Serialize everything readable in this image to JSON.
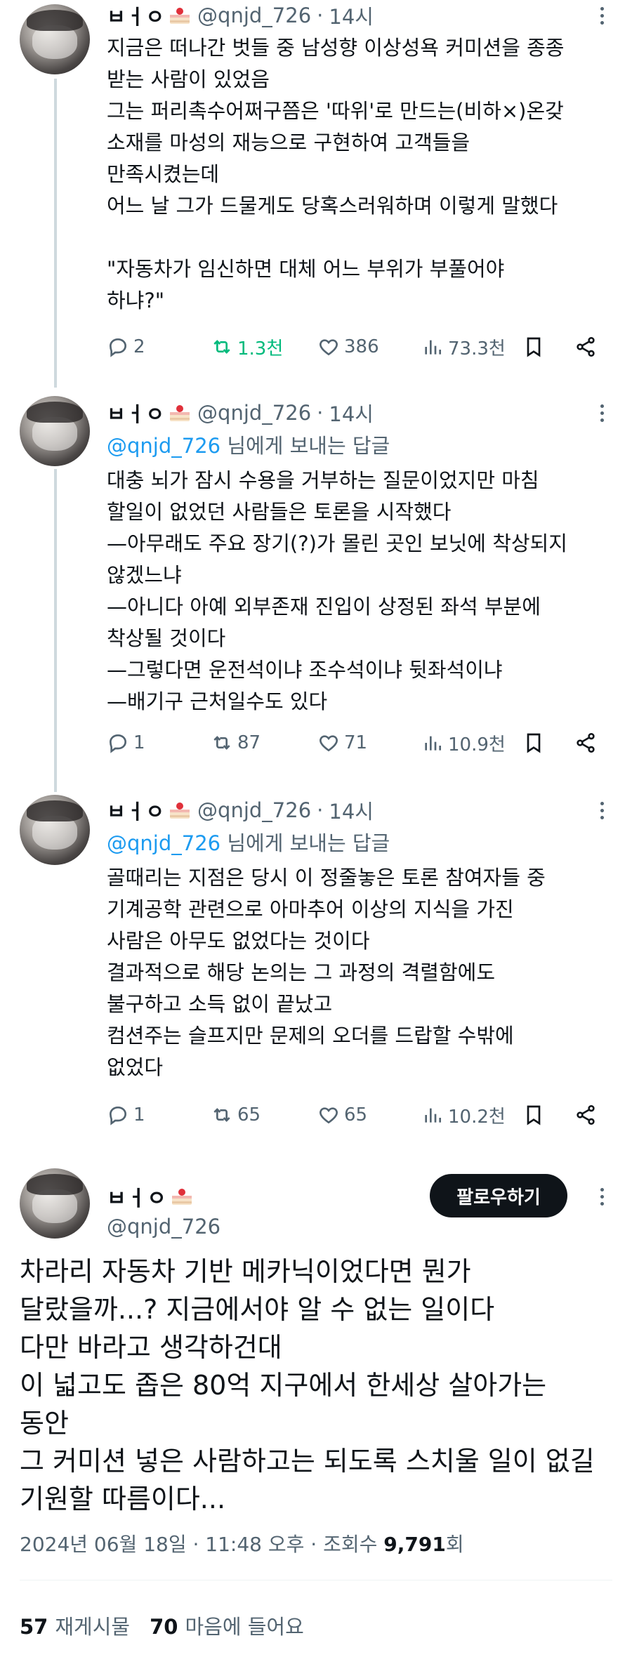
{
  "user": {
    "display_name": "ㅂㅓㅇ",
    "handle": "@qnjd_726",
    "handle_plain": "@qnjd_726"
  },
  "tweets": [
    {
      "time": "14시",
      "reply_to": "",
      "reply_suffix": "",
      "text": "지금은 떠나간 벗들 중 남성향 이상성욕 커미션을 종종\n받는 사람이 있었음\n그는 퍼리촉수어쩌구쯤은 '따위'로 만드는(비하×)온갖\n소재를 마성의 재능으로 구현하여 고객들을\n만족시켰는데\n어느 날 그가 드물게도 당혹스러워하며 이렇게 말했다\n\n\"자동차가 임신하면 대체 어느 부위가 부풀어야\n하냐?\"",
      "replies": "2",
      "retweets": "1.3천",
      "likes": "386",
      "views": "73.3천"
    },
    {
      "time": "14시",
      "reply_to": "@qnjd_726",
      "reply_suffix": " 님에게 보내는 답글",
      "text": "대충 뇌가 잠시 수용을 거부하는 질문이었지만 마침\n할일이 없었던 사람들은 토론을 시작했다\n—아무래도 주요 장기(?)가 몰린 곳인 보닛에 착상되지\n않겠느냐\n—아니다 아예 외부존재 진입이 상정된 좌석 부분에\n착상될 것이다\n—그렇다면 운전석이냐 조수석이냐 뒷좌석이냐\n—배기구 근처일수도 있다",
      "replies": "1",
      "retweets": "87",
      "likes": "71",
      "views": "10.9천"
    },
    {
      "time": "14시",
      "reply_to": "@qnjd_726",
      "reply_suffix": " 님에게 보내는 답글",
      "text": "골때리는 지점은 당시 이 정줄놓은 토론 참여자들 중\n기계공학 관련으로 아마추어 이상의 지식을 가진\n사람은 아무도 없었다는 것이다\n결과적으로 해당 논의는 그 과정의 격렬함에도\n불구하고 소득 없이 끝났고\n컴션주는 슬프지만 문제의 오더를 드랍할 수밖에\n없었다",
      "replies": "1",
      "retweets": "65",
      "likes": "65",
      "views": "10.2천"
    }
  ],
  "main": {
    "follow_label": "팔로우하기",
    "text": "차라리 자동차 기반 메카닉이었다면 뭔가\n달랐을까...? 지금에서야 알 수 없는 일이다\n다만 바라고 생각하건대\n이 넓고도 좁은 80억 지구에서 한세상 살아가는\n동안\n그 커미션 넣은 사람하고는 되도록 스치울 일이 없길\n기원할 따름이다...",
    "timestamp": "2024년 06월 18일 · 11:48 오후 · 조회수 ",
    "views": "9,791",
    "views_suffix": "회",
    "reposts_count": "57",
    "reposts_label": "재게시물",
    "likes_count": "70",
    "likes_label": "마음에 들어요"
  },
  "colors": {
    "retweet_active": "#00ba7c",
    "link": "#1d9bf0",
    "muted": "#536471"
  }
}
